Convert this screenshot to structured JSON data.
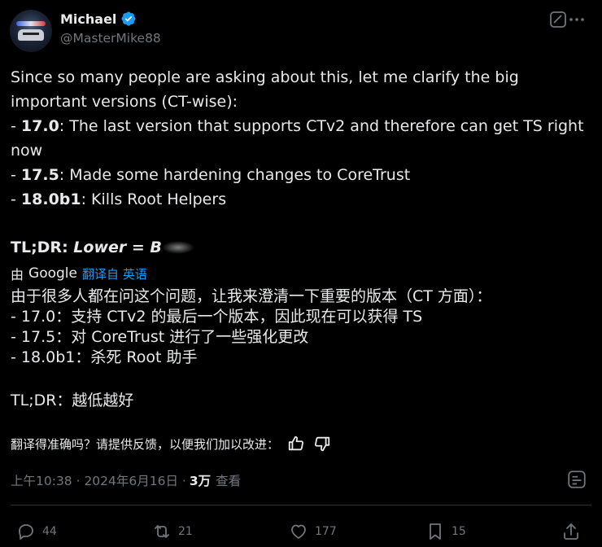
{
  "author": {
    "name": "Michael",
    "handle": "@MasterMike88"
  },
  "tweet": {
    "intro_line1": "Since so many people are asking about this, let me clarify the big",
    "intro_line2": "important versions (CT-wise):",
    "items": [
      {
        "version": "17.0",
        "text_line1": ": The last version that supports CTv2 and therefore can get TS right",
        "text_line2": "now"
      },
      {
        "version": "17.5",
        "text": ": Made some hardening changes to CoreTrust"
      },
      {
        "version": "18.0b1",
        "text": ": Kills Root Helpers"
      }
    ],
    "tldr_label": "TL;DR: ",
    "tldr_value": "Lower = B"
  },
  "translation": {
    "by": "由",
    "provider": "Google",
    "translated_from": "翻译自 英语",
    "intro": "由于很多人都在问这个问题，让我来澄清一下重要的版本（CT 方面）：",
    "items": [
      "- 17.0：支持 CTv2 的最后一个版本，因此现在可以获得 TS",
      "- 17.5：对 CoreTrust 进行了一些强化更改",
      "- 18.0b1：杀死 Root 助手"
    ],
    "tldr": "TL;DR：越低越好",
    "feedback": "翻译得准确吗？请提供反馈，以便我们加以改进："
  },
  "meta": {
    "time": "上午10:38 · 2024年6月16日 · ",
    "views": "3万",
    "views_label": "查看"
  },
  "actions": {
    "replies": "44",
    "reposts": "21",
    "likes": "177",
    "bookmarks": "15"
  },
  "icons": {
    "verified": "verified-badge-icon",
    "grok": "grok-icon",
    "more": "more-icon",
    "thumbs_up": "thumbs-up-icon",
    "thumbs_down": "thumbs-down-icon",
    "annotation": "note-icon",
    "reply": "reply-icon",
    "repost": "repost-icon",
    "like": "heart-icon",
    "bookmark": "bookmark-icon",
    "share": "share-icon"
  },
  "colors": {
    "background": "#000000",
    "text": "#e7e9ea",
    "secondary": "#71767b",
    "accent": "#1d9bf0",
    "divider": "#2f3336"
  }
}
